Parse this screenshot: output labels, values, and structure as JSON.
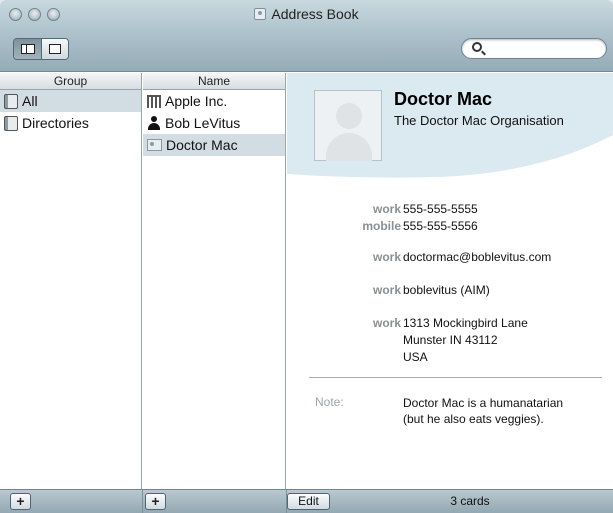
{
  "window": {
    "title": "Address Book"
  },
  "toolbar": {
    "view_buttons": [
      "column-view",
      "card-view"
    ],
    "search": {
      "placeholder": "",
      "value": ""
    }
  },
  "groups": {
    "header": "Group",
    "items": [
      {
        "label": "All",
        "selected": true
      },
      {
        "label": "Directories",
        "selected": false
      }
    ]
  },
  "names": {
    "header": "Name",
    "items": [
      {
        "label": "Apple Inc.",
        "icon": "company-icon",
        "selected": false
      },
      {
        "label": "Bob LeVitus",
        "icon": "person-icon",
        "selected": false
      },
      {
        "label": "Doctor Mac",
        "icon": "card-icon",
        "selected": true
      }
    ]
  },
  "card": {
    "name": "Doctor Mac",
    "organization": "The Doctor Mac Organisation",
    "phones": [
      {
        "label": "work",
        "value": "555-555-5555"
      },
      {
        "label": "mobile",
        "value": "555-555-5556"
      }
    ],
    "email": {
      "label": "work",
      "value": "doctormac@boblevitus.com"
    },
    "im": {
      "label": "work",
      "value": "boblevitus (AIM)"
    },
    "address": {
      "label": "work",
      "line1": "1313 Mockingbird Lane",
      "line2": "Munster IN 43112",
      "line3": "USA"
    },
    "note": {
      "label": "Note:",
      "line1": "Doctor Mac is a humanatarian",
      "line2": "(but he also eats veggies)."
    }
  },
  "bottombar": {
    "add_group": "+",
    "add_person": "+",
    "edit": "Edit",
    "count": "3 cards"
  }
}
